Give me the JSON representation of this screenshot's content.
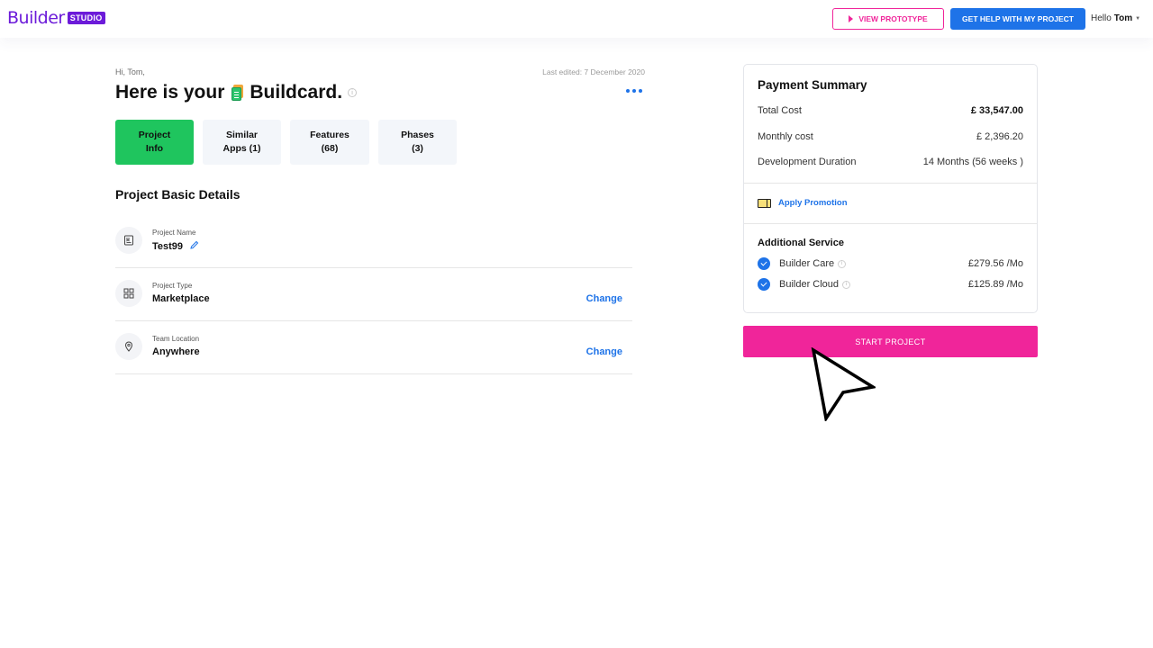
{
  "header": {
    "logo_word": "Builder",
    "logo_badge": "STUDIO",
    "view_prototype_label": "VIEW PROTOTYPE",
    "get_help_label": "GET HELP WITH MY PROJECT",
    "greeting_prefix": "Hello",
    "user_name": "Tom"
  },
  "main": {
    "greeting": "Hi, Tom,",
    "last_edited": "Last edited: 7 December 2020",
    "title_prefix": "Here is your",
    "title_word": "Buildcard.",
    "tabs": [
      {
        "line1": "Project",
        "line2": "Info",
        "active": true
      },
      {
        "line1": "Similar",
        "line2": "Apps (1)",
        "active": false
      },
      {
        "line1": "Features",
        "line2": "(68)",
        "active": false
      },
      {
        "line1": "Phases",
        "line2": "(3)",
        "active": false
      }
    ],
    "section_title": "Project Basic Details",
    "details": [
      {
        "label": "Project Name",
        "value": "Test99",
        "icon": "bookmark-icon",
        "action": ""
      },
      {
        "label": "Project Type",
        "value": "Marketplace",
        "icon": "grid-icon",
        "action": "Change"
      },
      {
        "label": "Team Location",
        "value": "Anywhere",
        "icon": "location-pin-icon",
        "action": "Change"
      }
    ]
  },
  "payment": {
    "title": "Payment Summary",
    "rows": [
      {
        "label": "Total Cost",
        "value": "£ 33,547.00"
      },
      {
        "label": "Monthly cost",
        "value": "£ 2,396.20"
      },
      {
        "label": "Development Duration",
        "value": "14 Months (56 weeks )"
      }
    ],
    "promo_label": "Apply Promotion",
    "additional_title": "Additional Service",
    "services": [
      {
        "name": "Builder Care",
        "price": "£279.56 /Mo"
      },
      {
        "name": "Builder Cloud",
        "price": "£125.89 /Mo"
      }
    ],
    "start_label": "START PROJECT"
  },
  "colors": {
    "brand_purple": "#6c1bd9",
    "accent_pink": "#f0259a",
    "accent_blue": "#1e73e8",
    "active_green": "#1fc55e"
  }
}
